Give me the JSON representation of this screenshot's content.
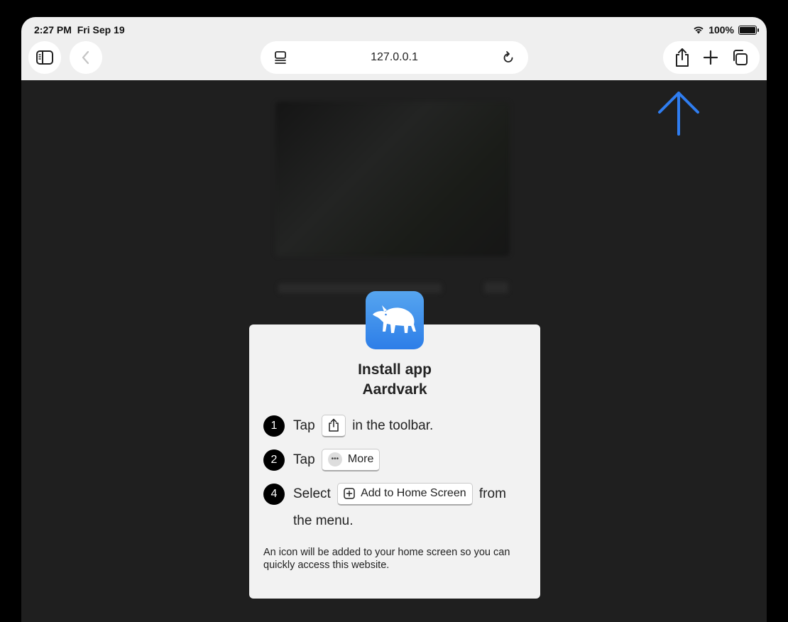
{
  "status_bar": {
    "time": "2:27 PM",
    "date": "Fri Sep 19",
    "battery_text": "100%",
    "battery_level": 1.0,
    "icons": [
      "wifi-icon",
      "battery-icon"
    ]
  },
  "toolbar": {
    "address": "127.0.0.1",
    "icons": [
      "sidebar-icon",
      "back-chevron-icon",
      "page-menu-icon",
      "reload-icon",
      "share-icon",
      "plus-icon",
      "tabs-icon"
    ]
  },
  "colors": {
    "accent": "#2f7df0",
    "card": "#f2f2f2",
    "page_bg": "#1f1f1f"
  },
  "install_card": {
    "title_line1": "Install app",
    "title_line2": "Aardvark",
    "app_icon": "aardvark-icon",
    "steps": [
      {
        "num": "1",
        "before": "Tap",
        "chip_icon": "share-icon",
        "chip_label": "",
        "after": "in the toolbar."
      },
      {
        "num": "2",
        "before": "Tap",
        "chip_icon": "more-icon",
        "chip_label": "More",
        "after": ""
      },
      {
        "num": "4",
        "before": "Select",
        "chip_icon": "plus-square-icon",
        "chip_label": "Add to Home Screen",
        "after": "from the menu."
      }
    ],
    "note": "An icon will be added to your home screen so you can quickly access this website."
  }
}
